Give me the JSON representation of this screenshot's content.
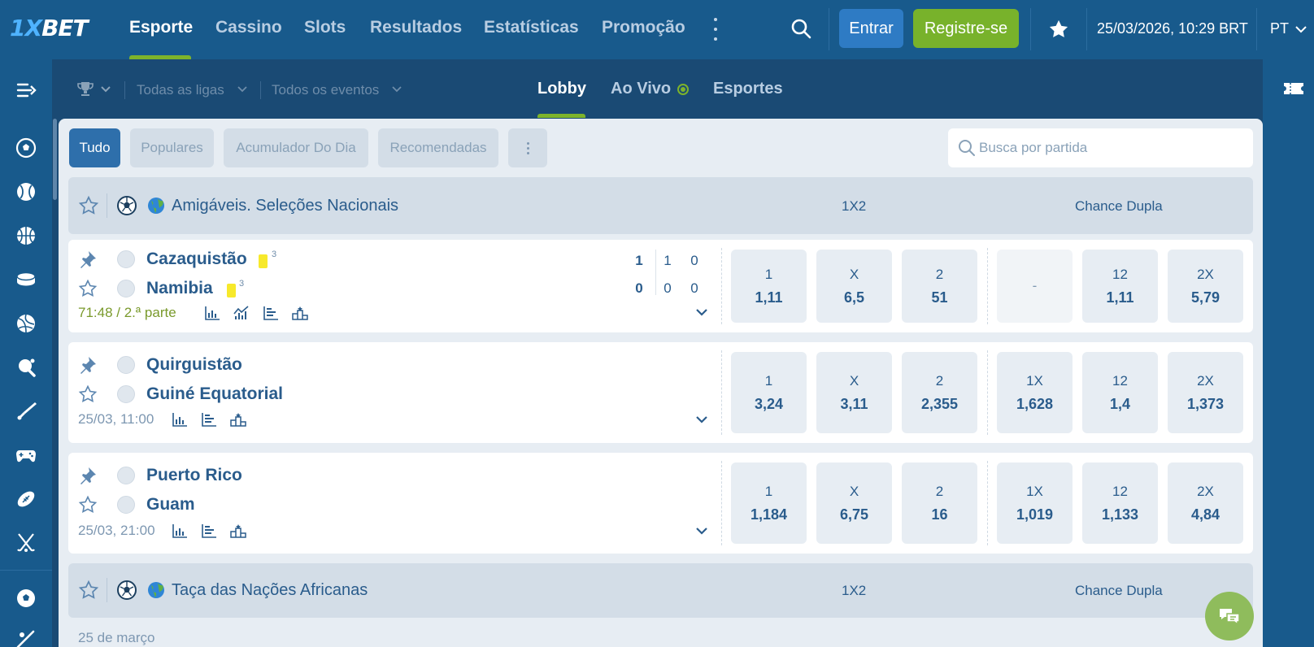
{
  "brand": {
    "logo_a": "1X",
    "logo_b": "BET"
  },
  "nav": {
    "items": [
      "Esporte",
      "Cassino",
      "Slots",
      "Resultados",
      "Estatísticas",
      "Promoção"
    ],
    "login": "Entrar",
    "register": "Registre-se",
    "datetime": "25/03/2026, 10:29 BRT",
    "language": "PT"
  },
  "filters": {
    "all_leagues": "Todas as ligas",
    "all_events": "Todos os eventos"
  },
  "tabs": {
    "lobby": "Lobby",
    "live": "Ao Vivo",
    "sports": "Esportes"
  },
  "chips": [
    "Tudo",
    "Populares",
    "Acumulador Do Dia",
    "Recomendadas"
  ],
  "search": {
    "placeholder": "Busca por partida"
  },
  "colors": {
    "header": "#185a8c",
    "accent_green": "#7db32b",
    "primary_blue": "#2e7bc4",
    "yellow_card": "#f7e92b"
  },
  "sidebar_icons": [
    "collapse-menu-icon",
    "football-icon",
    "baseball-icon",
    "basketball-icon",
    "ice-hockey-icon",
    "volleyball-icon",
    "table-tennis-icon",
    "badminton-icon",
    "esports-icon",
    "american-football-icon",
    "field-hockey-icon",
    "football-live-icon",
    "more-sports-icon"
  ],
  "leagues": [
    {
      "name": "Amigáveis. Seleções Nacionais",
      "market1": "1X2",
      "market2": "Chance Dupla"
    },
    {
      "name": "Taça das Nações Africanas",
      "market1": "1X2",
      "market2": "Chance Dupla"
    }
  ],
  "matches": [
    {
      "team1": "Cazaquistão",
      "team2": "Namibia",
      "info": "71:48  /  2.ª parte",
      "team1_cards": "3",
      "team2_cards": "3",
      "score": {
        "t1": [
          "1",
          "1",
          "0"
        ],
        "t2": [
          "0",
          "0",
          "0"
        ]
      },
      "odds": [
        {
          "label": "1",
          "value": "1,11"
        },
        {
          "label": "X",
          "value": "6,5"
        },
        {
          "label": "2",
          "value": "51"
        },
        {
          "label": "-",
          "value": ""
        },
        {
          "label": "12",
          "value": "1,11"
        },
        {
          "label": "2X",
          "value": "5,79"
        }
      ]
    },
    {
      "team1": "Quirguistão",
      "team2": "Guiné Equatorial",
      "info": "25/03, 11:00",
      "odds": [
        {
          "label": "1",
          "value": "3,24"
        },
        {
          "label": "X",
          "value": "3,11"
        },
        {
          "label": "2",
          "value": "2,355"
        },
        {
          "label": "1X",
          "value": "1,628"
        },
        {
          "label": "12",
          "value": "1,4"
        },
        {
          "label": "2X",
          "value": "1,373"
        }
      ]
    },
    {
      "team1": "Puerto Rico",
      "team2": "Guam",
      "info": "25/03, 21:00",
      "odds": [
        {
          "label": "1",
          "value": "1,184"
        },
        {
          "label": "X",
          "value": "6,75"
        },
        {
          "label": "2",
          "value": "16"
        },
        {
          "label": "1X",
          "value": "1,019"
        },
        {
          "label": "12",
          "value": "1,133"
        },
        {
          "label": "2X",
          "value": "4,84"
        }
      ]
    }
  ],
  "date_group": "25 de março"
}
